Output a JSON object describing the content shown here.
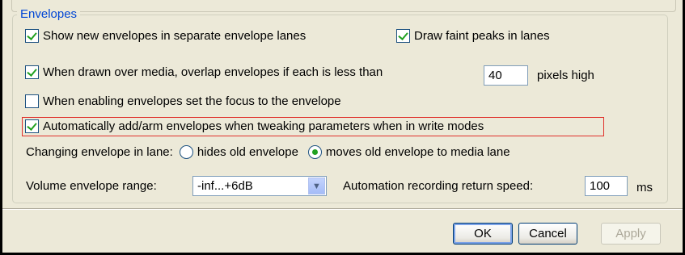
{
  "group": {
    "title": "Envelopes"
  },
  "options": {
    "separate_lanes": {
      "label": "Show new envelopes in separate envelope lanes",
      "checked": true
    },
    "faint_peaks": {
      "label": "Draw faint peaks in lanes",
      "checked": true
    },
    "overlap": {
      "label": "When drawn over media, overlap envelopes if each is less than",
      "checked": true,
      "value": "40",
      "suffix": "pixels high"
    },
    "focus": {
      "label": "When enabling envelopes set the focus to the envelope",
      "checked": false
    },
    "auto_arm": {
      "label": "Automatically add/arm envelopes when tweaking parameters when in write modes",
      "checked": true
    }
  },
  "lane_change": {
    "label": "Changing envelope in lane:",
    "options": [
      {
        "label": "hides old envelope",
        "selected": false
      },
      {
        "label": "moves old envelope to media lane",
        "selected": true
      }
    ]
  },
  "volume_range": {
    "label": "Volume envelope range:",
    "value": "-inf...+6dB"
  },
  "return_speed": {
    "label": "Automation recording return speed:",
    "value": "100",
    "unit": "ms"
  },
  "buttons": {
    "ok": "OK",
    "cancel": "Cancel",
    "apply": "Apply"
  },
  "colors": {
    "accent": "#0046d5",
    "highlight": "#e0302a",
    "check": "#21a121"
  }
}
